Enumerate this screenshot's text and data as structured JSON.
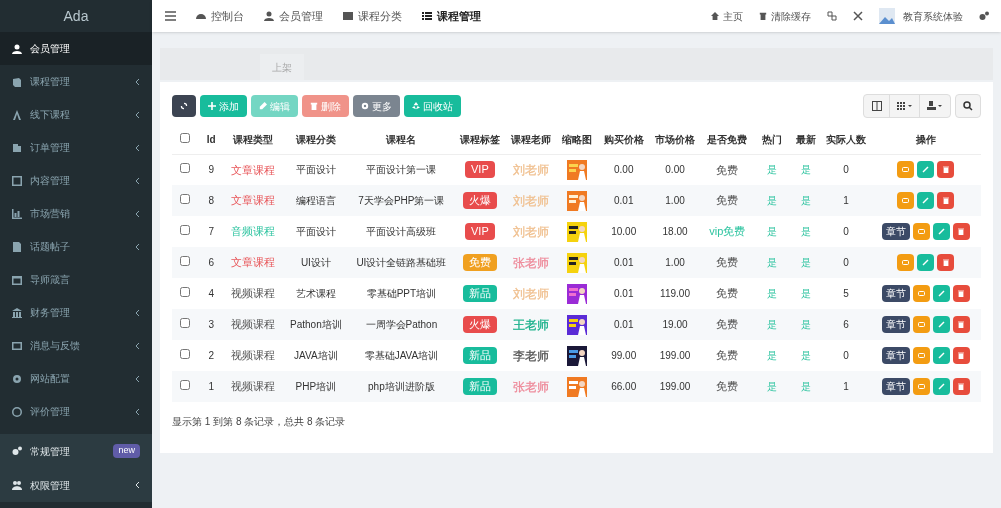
{
  "logo": "Ada",
  "sidebar": {
    "items": [
      {
        "label": "会员管理",
        "selected": true,
        "chevron": false
      },
      {
        "label": "课程管理",
        "selected": false,
        "chevron": true
      },
      {
        "label": "线下课程",
        "selected": false,
        "chevron": true
      },
      {
        "label": "订单管理",
        "selected": false,
        "chevron": true
      },
      {
        "label": "内容管理",
        "selected": false,
        "chevron": true
      },
      {
        "label": "市场营销",
        "selected": false,
        "chevron": true
      },
      {
        "label": "话题帖子",
        "selected": false,
        "chevron": true
      },
      {
        "label": "导师箴言",
        "selected": false,
        "chevron": false
      },
      {
        "label": "财务管理",
        "selected": false,
        "chevron": true
      },
      {
        "label": "消息与反馈",
        "selected": false,
        "chevron": true
      },
      {
        "label": "网站配置",
        "selected": false,
        "chevron": true
      },
      {
        "label": "评价管理",
        "selected": false,
        "chevron": true
      },
      {
        "label": "常规管理",
        "selected": false,
        "chevron": false,
        "badge": "new"
      },
      {
        "label": "权限管理",
        "selected": false,
        "chevron": true
      }
    ]
  },
  "topnav": {
    "items": [
      {
        "label": "控制台",
        "selected": false
      },
      {
        "label": "会员管理",
        "selected": false
      },
      {
        "label": "课程分类",
        "selected": false
      },
      {
        "label": "课程管理",
        "selected": true
      }
    ],
    "right": [
      "主页",
      "清除缓存"
    ],
    "user": "教育系统体验"
  },
  "tabs": [
    {
      "label": "上架",
      "selected": false
    }
  ],
  "toolbar": [
    {
      "kind": "refresh",
      "disabled": false
    },
    {
      "kind": "button",
      "label": "添加",
      "disabled": false
    },
    {
      "kind": "button",
      "label": "编辑",
      "disabled": true
    },
    {
      "kind": "button",
      "label": "删除",
      "disabled": true
    },
    {
      "kind": "button",
      "label": "更多",
      "disabled": false
    },
    {
      "kind": "button",
      "label": "回收站",
      "disabled": false
    }
  ],
  "table": {
    "all_checked": false,
    "columns": [
      "Id",
      "课程类型",
      "课程分类",
      "课程名",
      "课程标签",
      "课程老师",
      "缩略图",
      "购买价格",
      "市场价格",
      "是否免费",
      "热门",
      "最新",
      "实际人数",
      "操作"
    ],
    "rows": [
      {
        "checked": false,
        "id": "9",
        "type": {
          "text": "文章课程",
          "kind": "article"
        },
        "category": "平面设计",
        "name": "平面设计第一课",
        "tag": {
          "text": "VIP",
          "color": "#e84c4c"
        },
        "teacher": {
          "text": "刘老师",
          "color": "#f0c090"
        },
        "buy": "0.00",
        "market": "0.00",
        "free": {
          "text": "免费",
          "vip": false
        },
        "hot": "是",
        "newest": "是",
        "count": "0"
      },
      {
        "checked": false,
        "id": "8",
        "type": {
          "text": "文章课程",
          "kind": "article"
        },
        "category": "编程语言",
        "name": "7天学会PHP第一课",
        "tag": {
          "text": "火爆",
          "color": "#e84c4c"
        },
        "teacher": {
          "text": "刘老师",
          "color": "#f0c090"
        },
        "buy": "0.01",
        "market": "1.00",
        "free": {
          "text": "免费",
          "vip": false
        },
        "hot": "是",
        "newest": "是",
        "count": "1"
      },
      {
        "checked": false,
        "id": "7",
        "type": {
          "text": "音频课程",
          "kind": "audio"
        },
        "category": "平面设计",
        "name": "平面设计高级班",
        "tag": {
          "text": "VIP",
          "color": "#e84c4c"
        },
        "teacher": {
          "text": "刘老师",
          "color": "#f0c090"
        },
        "buy": "10.00",
        "market": "18.00",
        "free": {
          "text": "vip免费",
          "vip": true
        },
        "hot": "是",
        "newest": "是",
        "count": "0",
        "chapter": "章节"
      },
      {
        "checked": false,
        "id": "6",
        "type": {
          "text": "文章课程",
          "kind": "article"
        },
        "category": "UI设计",
        "name": "UI设计全链路基础班",
        "tag": {
          "text": "免费",
          "color": "#f0a020"
        },
        "teacher": {
          "text": "张老师",
          "color": "#ee8a9a"
        },
        "buy": "0.01",
        "market": "1.00",
        "free": {
          "text": "免费",
          "vip": false
        },
        "hot": "是",
        "newest": "是",
        "count": "0"
      },
      {
        "checked": false,
        "id": "4",
        "type": {
          "text": "视频课程",
          "kind": "video"
        },
        "category": "艺术课程",
        "name": "零基础PPT培训",
        "tag": {
          "text": "新品",
          "color": "#18bc9c"
        },
        "teacher": {
          "text": "刘老师",
          "color": "#f0c090"
        },
        "buy": "0.01",
        "market": "119.00",
        "free": {
          "text": "免费",
          "vip": false
        },
        "hot": "是",
        "newest": "是",
        "count": "5",
        "chapter": "章节"
      },
      {
        "checked": false,
        "id": "3",
        "type": {
          "text": "视频课程",
          "kind": "video"
        },
        "category": "Pathon培训",
        "name": "一周学会Pathon",
        "tag": {
          "text": "火爆",
          "color": "#e84c4c"
        },
        "teacher": {
          "text": "王老师",
          "color": "#18b08a"
        },
        "buy": "0.01",
        "market": "19.00",
        "free": {
          "text": "免费",
          "vip": false
        },
        "hot": "是",
        "newest": "是",
        "count": "6",
        "chapter": "章节"
      },
      {
        "checked": false,
        "id": "2",
        "type": {
          "text": "视频课程",
          "kind": "video"
        },
        "category": "JAVA培训",
        "name": "零基础JAVA培训",
        "tag": {
          "text": "新品",
          "color": "#18bc9c"
        },
        "teacher": {
          "text": "李老师",
          "color": "#555555"
        },
        "buy": "99.00",
        "market": "199.00",
        "free": {
          "text": "免费",
          "vip": false
        },
        "hot": "是",
        "newest": "是",
        "count": "0",
        "chapter": "章节"
      },
      {
        "checked": false,
        "id": "1",
        "type": {
          "text": "视频课程",
          "kind": "video"
        },
        "category": "PHP培训",
        "name": "php培训进阶版",
        "tag": {
          "text": "新品",
          "color": "#18bc9c"
        },
        "teacher": {
          "text": "张老师",
          "color": "#ee8a9a"
        },
        "buy": "66.00",
        "market": "199.00",
        "free": {
          "text": "免费",
          "vip": false
        },
        "hot": "是",
        "newest": "是",
        "count": "1",
        "chapter": "章节"
      }
    ]
  },
  "footer": "显示第 1 到第 8 条记录，总共 8 条记录"
}
